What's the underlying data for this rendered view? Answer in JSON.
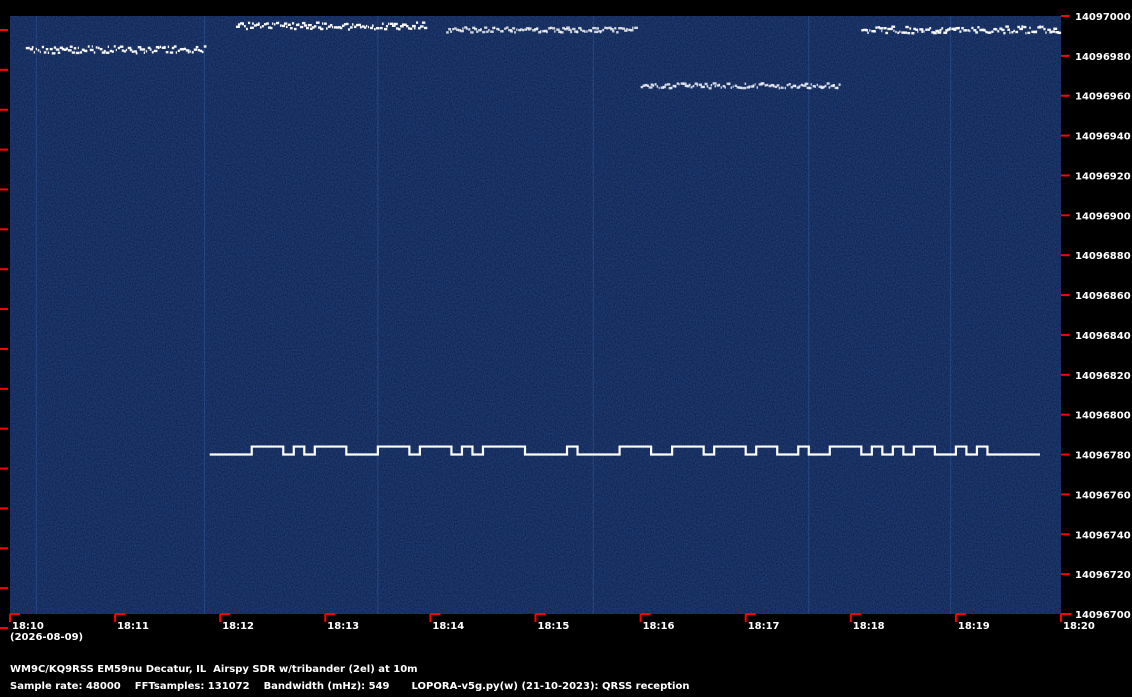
{
  "chart_data": {
    "type": "spectrogram",
    "x": {
      "start": "18:10",
      "end": "18:20",
      "tick_labels": [
        "18:10",
        "18:11",
        "18:12",
        "18:13",
        "18:14",
        "18:15",
        "18:16",
        "18:17",
        "18:18",
        "18:19",
        "18:20"
      ],
      "date": "(2026-08-09)"
    },
    "y": {
      "unit": "Hz",
      "ylim": [
        14096700,
        14097000
      ],
      "tick_labels": [
        "14097000",
        "14096980",
        "14096960",
        "14096940",
        "14096920",
        "14096900",
        "14096880",
        "14096860",
        "14096840",
        "14096820",
        "14096800",
        "14096780",
        "14096760",
        "14096740",
        "14096720",
        "14096700"
      ]
    },
    "colors": {
      "background": "#0a1a44",
      "signal": "#ffffff",
      "tick": "#ff0000",
      "faint": "#3b6fc0"
    },
    "signals": [
      {
        "start_min": 0.15,
        "end_min": 1.85,
        "freq_hz": 14096983,
        "style": "strong"
      },
      {
        "start_min": 2.15,
        "end_min": 3.95,
        "freq_hz": 14096995,
        "style": "strong"
      },
      {
        "start_min": 4.15,
        "end_min": 5.95,
        "freq_hz": 14096993,
        "style": "medium"
      },
      {
        "start_min": 6.0,
        "end_min": 7.9,
        "freq_hz": 14096965,
        "style": "medium"
      },
      {
        "start_min": 8.1,
        "end_min": 9.98,
        "freq_hz": 14096993,
        "style": "strong"
      }
    ],
    "fsk": {
      "start_min": 1.9,
      "end_min": 9.8,
      "low_hz": 14096780,
      "high_hz": 14096784,
      "segments": [
        [
          1.9,
          0
        ],
        [
          2.3,
          1
        ],
        [
          2.6,
          0
        ],
        [
          2.7,
          1
        ],
        [
          2.8,
          0
        ],
        [
          2.9,
          1
        ],
        [
          3.2,
          0
        ],
        [
          3.5,
          1
        ],
        [
          3.8,
          0
        ],
        [
          3.9,
          1
        ],
        [
          4.2,
          0
        ],
        [
          4.3,
          1
        ],
        [
          4.4,
          0
        ],
        [
          4.5,
          1
        ],
        [
          4.9,
          0
        ],
        [
          5.3,
          1
        ],
        [
          5.4,
          0
        ],
        [
          5.8,
          1
        ],
        [
          6.1,
          0
        ],
        [
          6.3,
          1
        ],
        [
          6.6,
          0
        ],
        [
          6.7,
          1
        ],
        [
          7.0,
          0
        ],
        [
          7.1,
          1
        ],
        [
          7.3,
          0
        ],
        [
          7.5,
          1
        ],
        [
          7.6,
          0
        ],
        [
          7.8,
          1
        ],
        [
          8.1,
          0
        ],
        [
          8.2,
          1
        ],
        [
          8.3,
          0
        ],
        [
          8.4,
          1
        ],
        [
          8.5,
          0
        ],
        [
          8.6,
          1
        ],
        [
          8.8,
          0
        ],
        [
          9.0,
          1
        ],
        [
          9.1,
          0
        ],
        [
          9.2,
          1
        ],
        [
          9.3,
          0
        ]
      ]
    }
  },
  "footer": {
    "station": "WM9C/KQ9RSS EM59nu Decatur, IL  Airspy SDR w/tribander (2el) at 10m",
    "sample_rate": "Sample rate: 48000",
    "fft_samples": "FFTsamples: 131072",
    "bandwidth": "Bandwidth (mHz): 549",
    "software": "LOPORA-v5g.py(w) (21-10-2023): QRSS reception"
  }
}
